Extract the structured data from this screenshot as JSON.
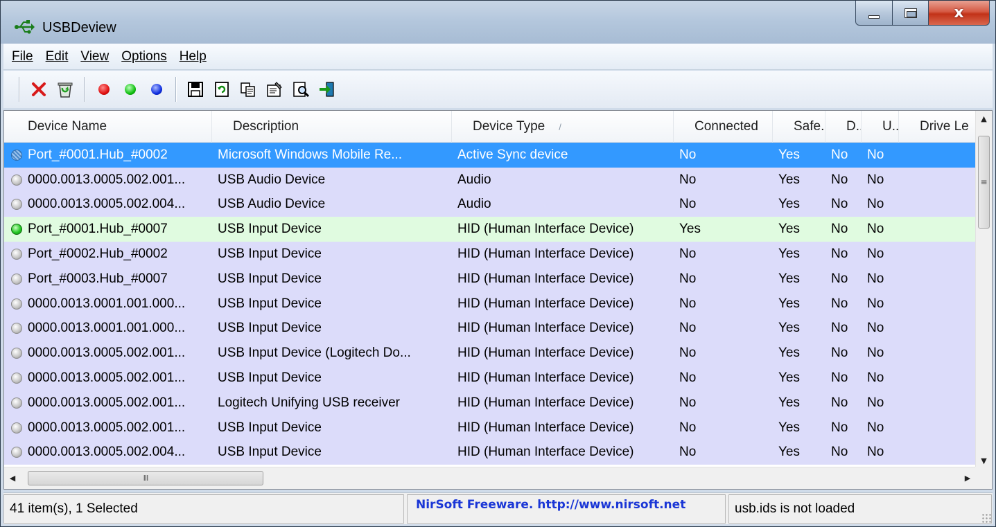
{
  "window": {
    "title": "USBDeview",
    "controls": {
      "close_glyph": "x"
    }
  },
  "menu": [
    "File",
    "Edit",
    "View",
    "Options",
    "Help"
  ],
  "toolbar": {
    "icons": [
      "uninstall-icon",
      "cleanup-icon",
      "disable-red-icon",
      "enable-green-icon",
      "disable-enable-blue-icon",
      "save-icon",
      "refresh-icon",
      "copy-icon",
      "properties-icon",
      "find-icon",
      "exit-icon"
    ],
    "colors": {
      "red": "#e01010",
      "green": "#10c010",
      "blue": "#1030e0"
    }
  },
  "columns": [
    "Device Name",
    "Description",
    "Device Type",
    "Connected",
    "Safe...",
    "D...",
    "U...",
    "Drive Le"
  ],
  "sort_indicator": "/",
  "rows": [
    {
      "name": "Port_#0001.Hub_#0002",
      "description": "Microsoft Windows Mobile Re...",
      "type": "Active Sync device",
      "connected": "No",
      "safe": "Yes",
      "d": "No",
      "u": "No",
      "drive": ""
    },
    {
      "name": "0000.0013.0005.002.001...",
      "description": "USB Audio Device",
      "type": "Audio",
      "connected": "No",
      "safe": "Yes",
      "d": "No",
      "u": "No",
      "drive": ""
    },
    {
      "name": "0000.0013.0005.002.004...",
      "description": "USB Audio Device",
      "type": "Audio",
      "connected": "No",
      "safe": "Yes",
      "d": "No",
      "u": "No",
      "drive": ""
    },
    {
      "name": "Port_#0001.Hub_#0007",
      "description": "USB Input Device",
      "type": "HID (Human Interface Device)",
      "connected": "Yes",
      "safe": "Yes",
      "d": "No",
      "u": "No",
      "drive": ""
    },
    {
      "name": "Port_#0002.Hub_#0002",
      "description": "USB Input Device",
      "type": "HID (Human Interface Device)",
      "connected": "No",
      "safe": "Yes",
      "d": "No",
      "u": "No",
      "drive": ""
    },
    {
      "name": "Port_#0003.Hub_#0007",
      "description": "USB Input Device",
      "type": "HID (Human Interface Device)",
      "connected": "No",
      "safe": "Yes",
      "d": "No",
      "u": "No",
      "drive": ""
    },
    {
      "name": "0000.0013.0001.001.000...",
      "description": "USB Input Device",
      "type": "HID (Human Interface Device)",
      "connected": "No",
      "safe": "Yes",
      "d": "No",
      "u": "No",
      "drive": ""
    },
    {
      "name": "0000.0013.0001.001.000...",
      "description": "USB Input Device",
      "type": "HID (Human Interface Device)",
      "connected": "No",
      "safe": "Yes",
      "d": "No",
      "u": "No",
      "drive": ""
    },
    {
      "name": "0000.0013.0005.002.001...",
      "description": "USB Input Device (Logitech Do...",
      "type": "HID (Human Interface Device)",
      "connected": "No",
      "safe": "Yes",
      "d": "No",
      "u": "No",
      "drive": ""
    },
    {
      "name": "0000.0013.0005.002.001...",
      "description": "USB Input Device",
      "type": "HID (Human Interface Device)",
      "connected": "No",
      "safe": "Yes",
      "d": "No",
      "u": "No",
      "drive": ""
    },
    {
      "name": "0000.0013.0005.002.001...",
      "description": "Logitech Unifying USB receiver",
      "type": "HID (Human Interface Device)",
      "connected": "No",
      "safe": "Yes",
      "d": "No",
      "u": "No",
      "drive": ""
    },
    {
      "name": "0000.0013.0005.002.001...",
      "description": "USB Input Device",
      "type": "HID (Human Interface Device)",
      "connected": "No",
      "safe": "Yes",
      "d": "No",
      "u": "No",
      "drive": ""
    },
    {
      "name": "0000.0013.0005.002.004...",
      "description": "USB Input Device",
      "type": "HID (Human Interface Device)",
      "connected": "No",
      "safe": "Yes",
      "d": "No",
      "u": "No",
      "drive": ""
    }
  ],
  "selected_row": 0,
  "scroll": {
    "h_thumb_glyph": "III",
    "v_thumb_glyph": "≡"
  },
  "status": {
    "items": "41 item(s), 1 Selected",
    "link": "NirSoft Freeware.  http://www.nirsoft.net",
    "usbids": "usb.ids is not loaded"
  },
  "colors": {
    "row_bg": "#dcdcfa",
    "connected_bg": "#e0fbe0",
    "selection": "#3399ff",
    "link": "#1a36d6"
  }
}
